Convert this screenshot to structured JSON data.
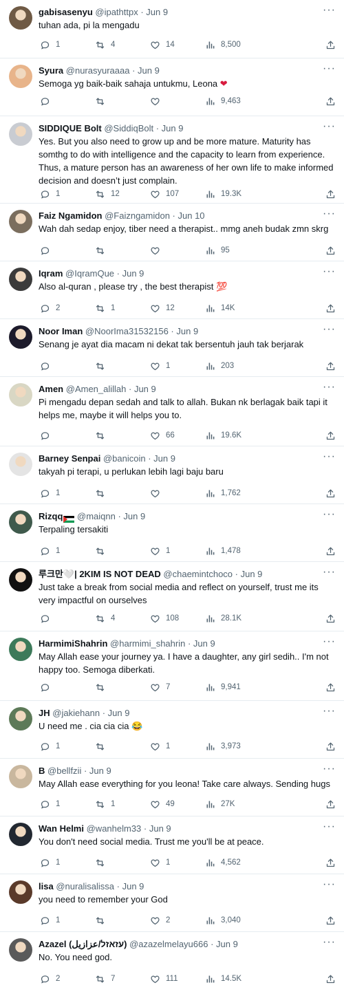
{
  "tweets": [
    {
      "name": "gabisasenyu",
      "handle": "@ipathttpx",
      "date": "Jun 9",
      "text": "tuhan ada, pi la mengadu",
      "replies": "1",
      "retweets": "4",
      "likes": "14",
      "views": "8,500",
      "avatar_color": "#6f5a45"
    },
    {
      "name": "Syura",
      "handle": "@nurasyuraaaa",
      "date": "Jun 9",
      "text": "Semoga yg baik-baik sahaja untukmu, Leona",
      "text_heart": "❤",
      "replies": "",
      "retweets": "",
      "likes": "",
      "views": "9,463",
      "avatar_color": "#e8b48a"
    },
    {
      "name": "SIDDIQUE Bolt",
      "handle": "@SiddiqBolt",
      "date": "Jun 9",
      "text": "Yes. But you also need to grow up and be more mature. Maturity has somthg to do with intelligence and the capacity to learn from experience. Thus, a mature person has an awareness of her own life to make informed decision and doesn’t just complain.",
      "replies": "1",
      "retweets": "12",
      "likes": "107",
      "views": "19.3K",
      "avatar_color": "#c9ccd2"
    },
    {
      "name": "Faiz Ngamidon",
      "handle": "@Faizngamidon",
      "date": "Jun 10",
      "text": "Wah dah sedap enjoy, tiber need a therapist.. mmg aneh budak zmn skrg",
      "replies": "",
      "retweets": "",
      "likes": "",
      "views": "95",
      "avatar_color": "#7b6e5e"
    },
    {
      "name": "Iqram",
      "handle": "@IqramQue",
      "date": "Jun 9",
      "text": "Also al-quran , please try , the best therapist",
      "text_emoji": "💯",
      "replies": "2",
      "retweets": "1",
      "likes": "12",
      "views": "14K",
      "avatar_color": "#3b3b3b"
    },
    {
      "name": "Noor Iman",
      "handle": "@NoorIma31532156",
      "date": "Jun 9",
      "text": "Senang je ayat dia macam ni dekat tak bersentuh jauh tak berjarak",
      "replies": "",
      "retweets": "",
      "likes": "1",
      "views": "203",
      "avatar_color": "#1d1b2b"
    },
    {
      "name": "Amen",
      "handle": "@Amen_alillah",
      "date": "Jun 9",
      "text": "Pi mengadu depan sedah and  talk to allah. Bukan nk berlagak baik tapi it helps me, maybe it will helps you to.",
      "replies": "",
      "retweets": "",
      "likes": "66",
      "views": "19.6K",
      "avatar_color": "#d9d7c4"
    },
    {
      "name": "Barney Senpai",
      "handle": "@banicoin",
      "date": "Jun 9",
      "text": "takyah pi terapi, u perlukan lebih lagi baju baru",
      "replies": "1",
      "retweets": "",
      "likes": "",
      "views": "1,762",
      "avatar_color": "#e4e4e4"
    },
    {
      "name": "Rizqq",
      "handle": "@maiqnn",
      "date": "Jun 9",
      "text": "Terpaling tersakiti",
      "replies": "1",
      "retweets": "",
      "likes": "1",
      "views": "1,478",
      "avatar_color": "#3f5a4c"
    },
    {
      "name": "루크만🤍| 2KIM IS NOT DEAD",
      "handle": "@chaemintchoco",
      "date": "Jun 9",
      "text": "Just take a break from social media and reflect on yourself, trust me its very impactful on ourselves",
      "replies": "",
      "retweets": "4",
      "likes": "108",
      "views": "28.1K",
      "avatar_color": "#111111"
    },
    {
      "name": "HarmimiShahrin",
      "handle": "@harmimi_shahrin",
      "date": "Jun 9",
      "text": "May Allah ease your journey ya. I have a daughter, any girl sedih.. I'm not happy too. Semoga diberkati.",
      "replies": "",
      "retweets": "",
      "likes": "7",
      "views": "9,941",
      "avatar_color": "#3d7a5a"
    },
    {
      "name": "JH",
      "handle": "@jakiehann",
      "date": "Jun 9",
      "text": "U need me . cia cia cia",
      "text_emoji": "😂",
      "replies": "1",
      "retweets": "",
      "likes": "1",
      "views": "3,973",
      "avatar_color": "#5d7a58"
    },
    {
      "name": "B",
      "handle": "@bellfzii",
      "date": "Jun 9",
      "text": "May Allah ease everything for you leona! Take care always. Sending hugs",
      "replies": "1",
      "retweets": "1",
      "likes": "49",
      "views": "27K",
      "avatar_color": "#c9b79e"
    },
    {
      "name": "Wan Helmi",
      "handle": "@wanhelm33",
      "date": "Jun 9",
      "text": "You don't need social media. Trust me you'll be at peace.",
      "replies": "1",
      "retweets": "",
      "likes": "1",
      "views": "4,562",
      "avatar_color": "#222831"
    },
    {
      "name": "lisa",
      "handle": "@nuralisalissa",
      "date": "Jun 9",
      "text": "you need to remember your God",
      "replies": "1",
      "retweets": "",
      "likes": "2",
      "views": "3,040",
      "avatar_color": "#5a3a2a"
    },
    {
      "name": "Azazel (עזאזל/عزازيل)",
      "handle": "@azazelmelayu666",
      "date": "Jun 9",
      "text": "No. You need god.",
      "replies": "2",
      "retweets": "7",
      "likes": "111",
      "views": "14.5K",
      "avatar_color": "#5a5a5a"
    }
  ],
  "colors": {
    "muted": "#536471",
    "text": "#0f1419",
    "divider": "#e6ecf0",
    "like_heart": "#d81b3e"
  }
}
